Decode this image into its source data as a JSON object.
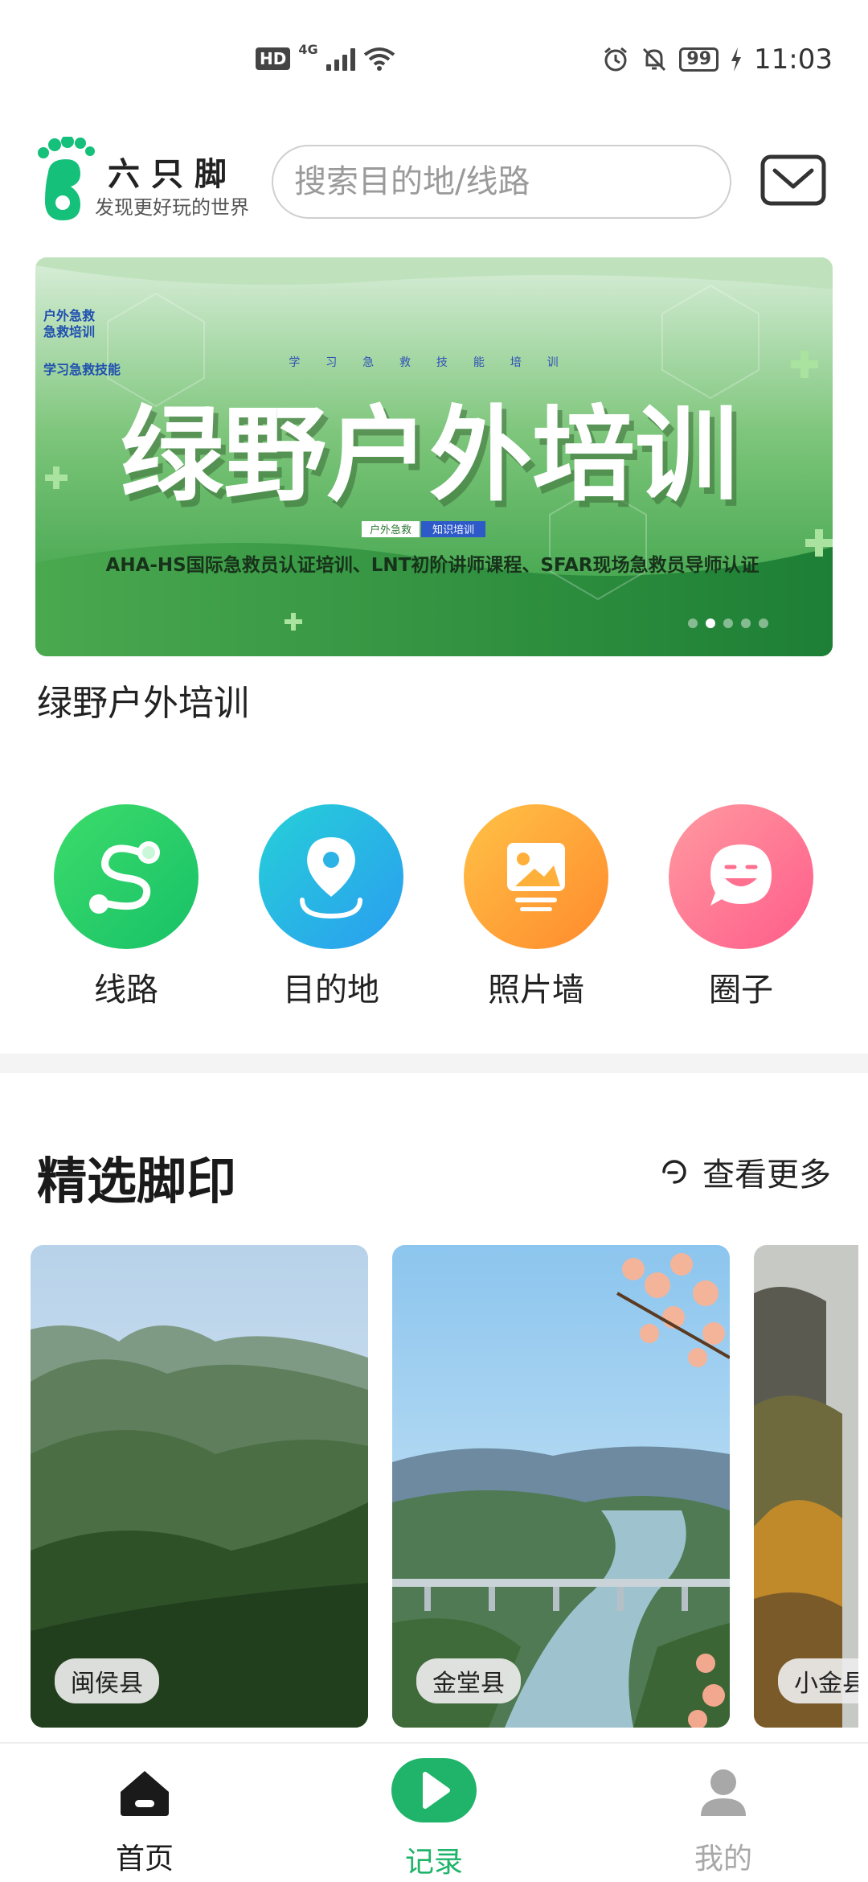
{
  "status_bar": {
    "hd": "HD",
    "network": "4G",
    "battery": "99",
    "time": "11:03"
  },
  "header": {
    "brand_name": "六只脚",
    "brand_tagline": "发现更好玩的世界",
    "search_placeholder": "搜索目的地/线路"
  },
  "banner": {
    "subtitle_top": "学 习 急 救 技 能 培 训",
    "side_text_1": "户外急救",
    "side_text_2": "急救培训",
    "side_text_3": "学习急救技能",
    "headline": "绿野户外培训",
    "chip_1": "户外急救",
    "chip_2": "知识培训",
    "courses": "AHA-HS国际急救员认证培训、LNT初阶讲师课程、SFAR现场急救员导师认证",
    "caption": "绿野户外培训",
    "slide_count": 5,
    "active_slide": 2
  },
  "quick_nav": [
    {
      "label": "线路",
      "icon": "route-icon",
      "color_from": "#3ddc6a",
      "color_to": "#17c168"
    },
    {
      "label": "目的地",
      "icon": "location-pin-icon",
      "color_from": "#26d0d8",
      "color_to": "#2a9df0"
    },
    {
      "label": "照片墙",
      "icon": "photo-icon",
      "color_from": "#ffc247",
      "color_to": "#ff8a2c"
    },
    {
      "label": "圈子",
      "icon": "chat-smile-icon",
      "color_from": "#ff9aa0",
      "color_to": "#ff5c8a"
    }
  ],
  "featured": {
    "title": "精选脚印",
    "more_label": "查看更多",
    "cards": [
      {
        "location": "闽侯县"
      },
      {
        "location": "金堂县"
      },
      {
        "location": "小金县"
      }
    ]
  },
  "bottom_nav": [
    {
      "label": "首页",
      "icon": "home-icon",
      "active": true
    },
    {
      "label": "记录",
      "icon": "record-play-icon",
      "active": false
    },
    {
      "label": "我的",
      "icon": "profile-icon",
      "active": false
    }
  ],
  "colors": {
    "brand_green": "#14c07a",
    "record_green": "#1fb46a",
    "inactive_gray": "#a8a8a8"
  }
}
